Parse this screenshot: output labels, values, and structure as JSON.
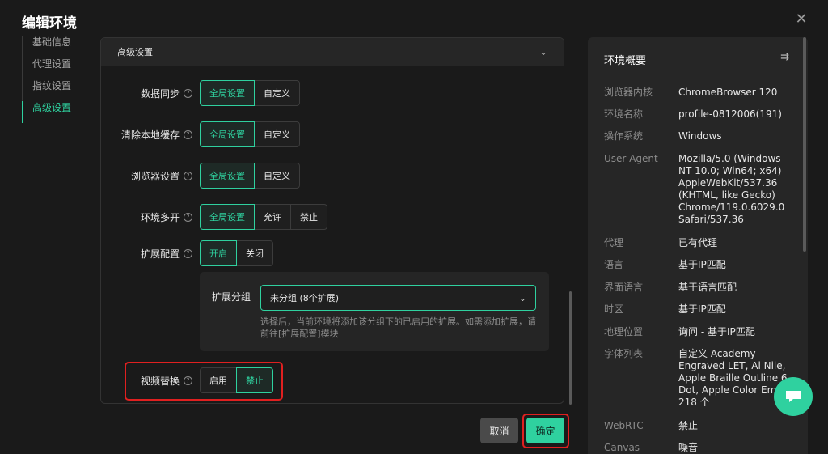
{
  "dialog": {
    "title": "编辑环境",
    "close_icon": "close-icon"
  },
  "nav": {
    "items": [
      {
        "label": "基础信息",
        "active": false
      },
      {
        "label": "代理设置",
        "active": false
      },
      {
        "label": "指纹设置",
        "active": false
      },
      {
        "label": "高级设置",
        "active": true
      }
    ]
  },
  "section": {
    "title": "高级设置",
    "rows": [
      {
        "label": "数据同步",
        "options": [
          "全局设置",
          "自定义"
        ],
        "selected": 0
      },
      {
        "label": "清除本地缓存",
        "options": [
          "全局设置",
          "自定义"
        ],
        "selected": 0
      },
      {
        "label": "浏览器设置",
        "options": [
          "全局设置",
          "自定义"
        ],
        "selected": 0
      },
      {
        "label": "环境多开",
        "options": [
          "全局设置",
          "允许",
          "禁止"
        ],
        "selected": 0
      },
      {
        "label": "扩展配置",
        "options": [
          "开启",
          "关闭"
        ],
        "selected": 0
      }
    ],
    "extension_group": {
      "label": "扩展分组",
      "value": "未分组 (8个扩展)",
      "hint": "选择后，当前环境将添加该分组下的已启用的扩展。如需添加扩展，请前往[扩展配置]模块"
    },
    "video_replace": {
      "label": "视频替换",
      "options": [
        "启用",
        "禁止"
      ],
      "selected": 1
    }
  },
  "footer": {
    "cancel_label": "取消",
    "ok_label": "确定"
  },
  "summary": {
    "title": "环境概要",
    "items": [
      {
        "key": "浏览器内核",
        "value": "ChromeBrowser 120"
      },
      {
        "key": "环境名称",
        "value": "profile-0812006(191)"
      },
      {
        "key": "操作系统",
        "value": "Windows"
      },
      {
        "key": "User Agent",
        "value": "Mozilla/5.0 (Windows NT 10.0; Win64; x64) AppleWebKit/537.36 (KHTML, like Gecko) Chrome/119.0.6029.0 Safari/537.36"
      },
      {
        "key": "代理",
        "value": "已有代理"
      },
      {
        "key": "语言",
        "value": "基于IP匹配"
      },
      {
        "key": "界面语言",
        "value": "基于语言匹配"
      },
      {
        "key": "时区",
        "value": "基于IP匹配"
      },
      {
        "key": "地理位置",
        "value": "询问 - 基于IP匹配"
      },
      {
        "key": "字体列表",
        "value": "自定义 Academy Engraved LET, Al Nile, Apple Braille Outline 6 Dot, Apple Color Emoji 218 个"
      },
      {
        "key": "WebRTC",
        "value": "禁止"
      },
      {
        "key": "Canvas",
        "value": "噪音"
      }
    ]
  },
  "colors": {
    "accent": "#2fd19f",
    "highlight": "#e02020",
    "background": "#1a1a1a"
  }
}
